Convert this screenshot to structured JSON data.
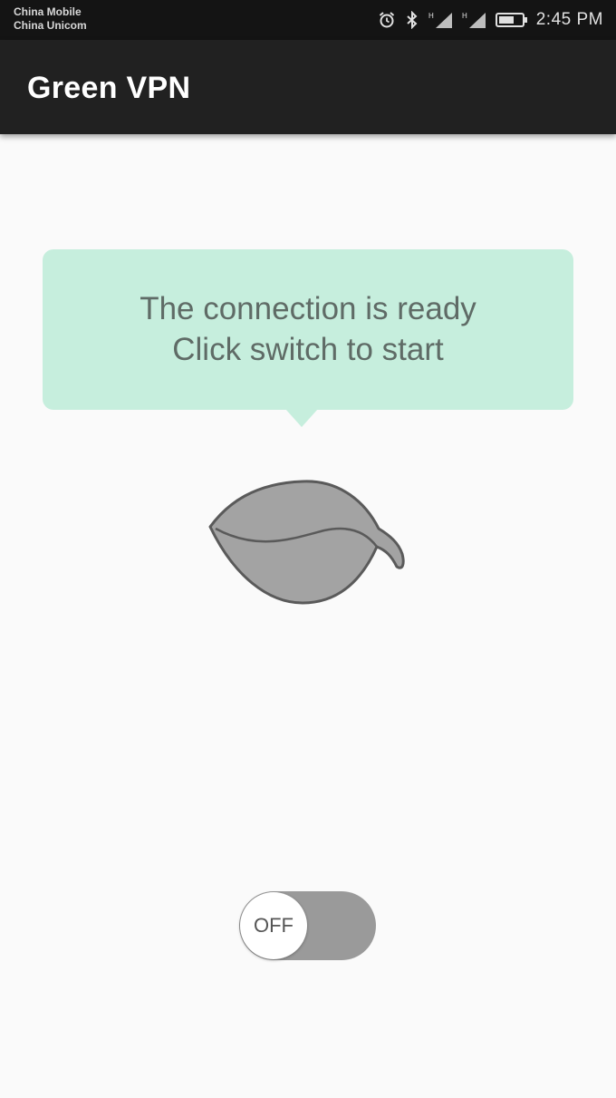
{
  "status_bar": {
    "carrier_1": "China Mobile",
    "carrier_2": "China Unicom",
    "time": "2:45 PM",
    "icons": [
      "alarm-icon",
      "bluetooth-icon",
      "signal-icon",
      "signal-icon",
      "battery-icon"
    ]
  },
  "app_bar": {
    "title": "Green VPN"
  },
  "message": {
    "line_1": "The connection is ready",
    "line_2": "Click switch to start"
  },
  "toggle": {
    "label": "OFF",
    "state": "off"
  },
  "colors": {
    "bubble": "#c6eedd",
    "toggle_track": "#9a9a9a",
    "leaf_fill": "#a3a3a3"
  }
}
